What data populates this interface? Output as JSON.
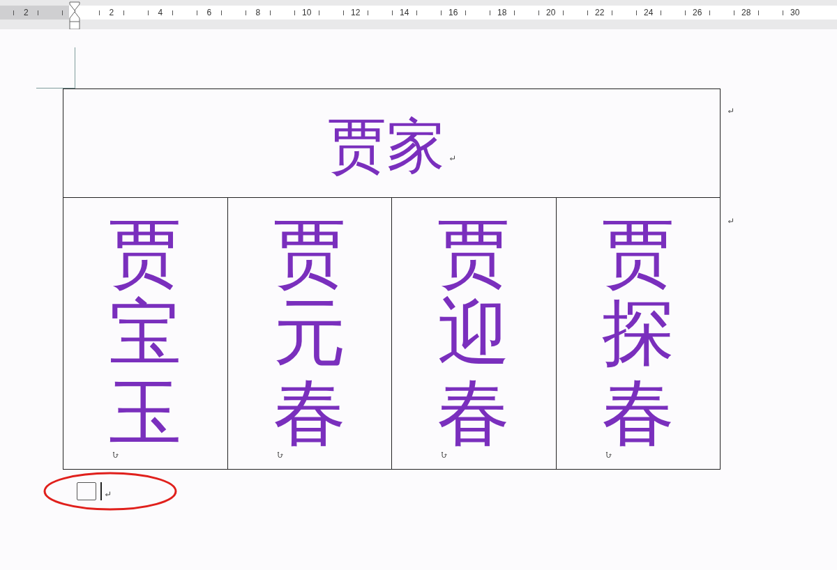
{
  "ruler": {
    "left_labels": [
      "2"
    ],
    "labels": [
      "2",
      "4",
      "6",
      "8",
      "10",
      "12",
      "14",
      "16",
      "18",
      "20",
      "22",
      "24",
      "26",
      "28",
      "30"
    ]
  },
  "table": {
    "header": "贾家",
    "cells": [
      "贾宝玉",
      "贾元春",
      "贾迎春",
      "贾探春"
    ]
  }
}
